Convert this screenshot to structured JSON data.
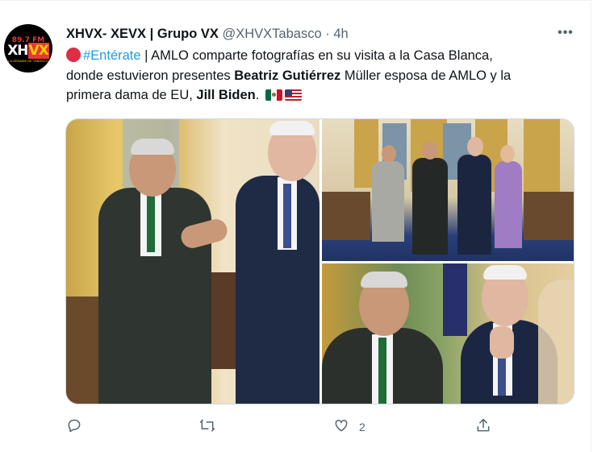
{
  "tweet": {
    "author": {
      "name": "XHVX- XEVX | Grupo VX",
      "handle": "@XHVXTabasco",
      "separator": "·",
      "time": "4h",
      "avatar": {
        "frequency": "89.7 FM",
        "logo_left": "XH",
        "logo_right": "VX",
        "tagline": "LA GRANDE DE TABASCO"
      }
    },
    "more_label": "•••",
    "body": {
      "hashtag": "#Entérate",
      "text_1": " | AMLO comparte fotografías en su visita a la Casa Blanca,",
      "text_2": "donde estuvieron presentes ",
      "bold_1": "Beatriz Gutiérrez",
      "text_3": " Müller esposa de AMLO y la",
      "text_4": "primera dama de EU, ",
      "bold_2": "Jill Biden",
      "text_5": ". "
    },
    "media": {
      "photos": [
        {
          "name": "photo-1"
        },
        {
          "name": "photo-2"
        },
        {
          "name": "photo-3"
        }
      ]
    },
    "actions": {
      "reply_icon": "reply-icon",
      "retweet_icon": "retweet-icon",
      "like_icon": "heart-icon",
      "like_count": "2",
      "share_icon": "share-icon"
    },
    "colors": {
      "accent": "#1d9bf0",
      "text": "#0f1419",
      "secondary": "#536471",
      "border": "#cfd9de"
    }
  }
}
